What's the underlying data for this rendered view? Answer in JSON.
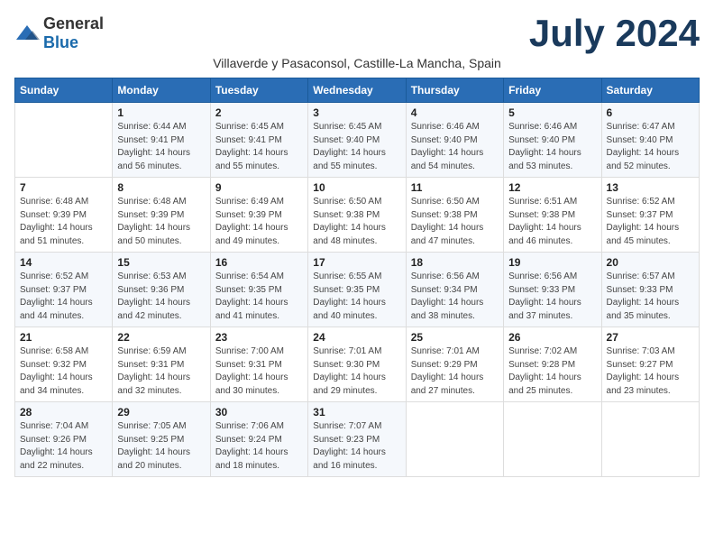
{
  "header": {
    "logo_general": "General",
    "logo_blue": "Blue",
    "month_title": "July 2024",
    "subtitle": "Villaverde y Pasaconsol, Castille-La Mancha, Spain"
  },
  "columns": [
    "Sunday",
    "Monday",
    "Tuesday",
    "Wednesday",
    "Thursday",
    "Friday",
    "Saturday"
  ],
  "weeks": [
    [
      {
        "day": "",
        "info": ""
      },
      {
        "day": "1",
        "info": "Sunrise: 6:44 AM\nSunset: 9:41 PM\nDaylight: 14 hours\nand 56 minutes."
      },
      {
        "day": "2",
        "info": "Sunrise: 6:45 AM\nSunset: 9:41 PM\nDaylight: 14 hours\nand 55 minutes."
      },
      {
        "day": "3",
        "info": "Sunrise: 6:45 AM\nSunset: 9:40 PM\nDaylight: 14 hours\nand 55 minutes."
      },
      {
        "day": "4",
        "info": "Sunrise: 6:46 AM\nSunset: 9:40 PM\nDaylight: 14 hours\nand 54 minutes."
      },
      {
        "day": "5",
        "info": "Sunrise: 6:46 AM\nSunset: 9:40 PM\nDaylight: 14 hours\nand 53 minutes."
      },
      {
        "day": "6",
        "info": "Sunrise: 6:47 AM\nSunset: 9:40 PM\nDaylight: 14 hours\nand 52 minutes."
      }
    ],
    [
      {
        "day": "7",
        "info": "Sunrise: 6:48 AM\nSunset: 9:39 PM\nDaylight: 14 hours\nand 51 minutes."
      },
      {
        "day": "8",
        "info": "Sunrise: 6:48 AM\nSunset: 9:39 PM\nDaylight: 14 hours\nand 50 minutes."
      },
      {
        "day": "9",
        "info": "Sunrise: 6:49 AM\nSunset: 9:39 PM\nDaylight: 14 hours\nand 49 minutes."
      },
      {
        "day": "10",
        "info": "Sunrise: 6:50 AM\nSunset: 9:38 PM\nDaylight: 14 hours\nand 48 minutes."
      },
      {
        "day": "11",
        "info": "Sunrise: 6:50 AM\nSunset: 9:38 PM\nDaylight: 14 hours\nand 47 minutes."
      },
      {
        "day": "12",
        "info": "Sunrise: 6:51 AM\nSunset: 9:38 PM\nDaylight: 14 hours\nand 46 minutes."
      },
      {
        "day": "13",
        "info": "Sunrise: 6:52 AM\nSunset: 9:37 PM\nDaylight: 14 hours\nand 45 minutes."
      }
    ],
    [
      {
        "day": "14",
        "info": "Sunrise: 6:52 AM\nSunset: 9:37 PM\nDaylight: 14 hours\nand 44 minutes."
      },
      {
        "day": "15",
        "info": "Sunrise: 6:53 AM\nSunset: 9:36 PM\nDaylight: 14 hours\nand 42 minutes."
      },
      {
        "day": "16",
        "info": "Sunrise: 6:54 AM\nSunset: 9:35 PM\nDaylight: 14 hours\nand 41 minutes."
      },
      {
        "day": "17",
        "info": "Sunrise: 6:55 AM\nSunset: 9:35 PM\nDaylight: 14 hours\nand 40 minutes."
      },
      {
        "day": "18",
        "info": "Sunrise: 6:56 AM\nSunset: 9:34 PM\nDaylight: 14 hours\nand 38 minutes."
      },
      {
        "day": "19",
        "info": "Sunrise: 6:56 AM\nSunset: 9:33 PM\nDaylight: 14 hours\nand 37 minutes."
      },
      {
        "day": "20",
        "info": "Sunrise: 6:57 AM\nSunset: 9:33 PM\nDaylight: 14 hours\nand 35 minutes."
      }
    ],
    [
      {
        "day": "21",
        "info": "Sunrise: 6:58 AM\nSunset: 9:32 PM\nDaylight: 14 hours\nand 34 minutes."
      },
      {
        "day": "22",
        "info": "Sunrise: 6:59 AM\nSunset: 9:31 PM\nDaylight: 14 hours\nand 32 minutes."
      },
      {
        "day": "23",
        "info": "Sunrise: 7:00 AM\nSunset: 9:31 PM\nDaylight: 14 hours\nand 30 minutes."
      },
      {
        "day": "24",
        "info": "Sunrise: 7:01 AM\nSunset: 9:30 PM\nDaylight: 14 hours\nand 29 minutes."
      },
      {
        "day": "25",
        "info": "Sunrise: 7:01 AM\nSunset: 9:29 PM\nDaylight: 14 hours\nand 27 minutes."
      },
      {
        "day": "26",
        "info": "Sunrise: 7:02 AM\nSunset: 9:28 PM\nDaylight: 14 hours\nand 25 minutes."
      },
      {
        "day": "27",
        "info": "Sunrise: 7:03 AM\nSunset: 9:27 PM\nDaylight: 14 hours\nand 23 minutes."
      }
    ],
    [
      {
        "day": "28",
        "info": "Sunrise: 7:04 AM\nSunset: 9:26 PM\nDaylight: 14 hours\nand 22 minutes."
      },
      {
        "day": "29",
        "info": "Sunrise: 7:05 AM\nSunset: 9:25 PM\nDaylight: 14 hours\nand 20 minutes."
      },
      {
        "day": "30",
        "info": "Sunrise: 7:06 AM\nSunset: 9:24 PM\nDaylight: 14 hours\nand 18 minutes."
      },
      {
        "day": "31",
        "info": "Sunrise: 7:07 AM\nSunset: 9:23 PM\nDaylight: 14 hours\nand 16 minutes."
      },
      {
        "day": "",
        "info": ""
      },
      {
        "day": "",
        "info": ""
      },
      {
        "day": "",
        "info": ""
      }
    ]
  ]
}
